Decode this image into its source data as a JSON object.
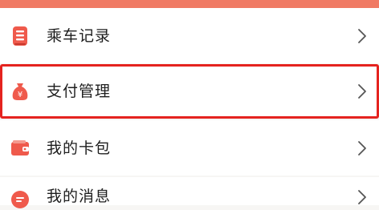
{
  "menu": {
    "items": [
      {
        "label": "乘车记录",
        "icon": "ride-record-icon",
        "highlighted": false
      },
      {
        "label": "支付管理",
        "icon": "money-bag-icon",
        "highlighted": true
      },
      {
        "label": "我的卡包",
        "icon": "wallet-icon",
        "highlighted": false
      },
      {
        "label": "我的消息",
        "icon": "message-icon",
        "highlighted": false
      }
    ]
  },
  "colors": {
    "accent": "#f07a64",
    "icon_red": "#ef5a4c",
    "highlight_border": "#e5231f",
    "chevron": "#555555"
  }
}
